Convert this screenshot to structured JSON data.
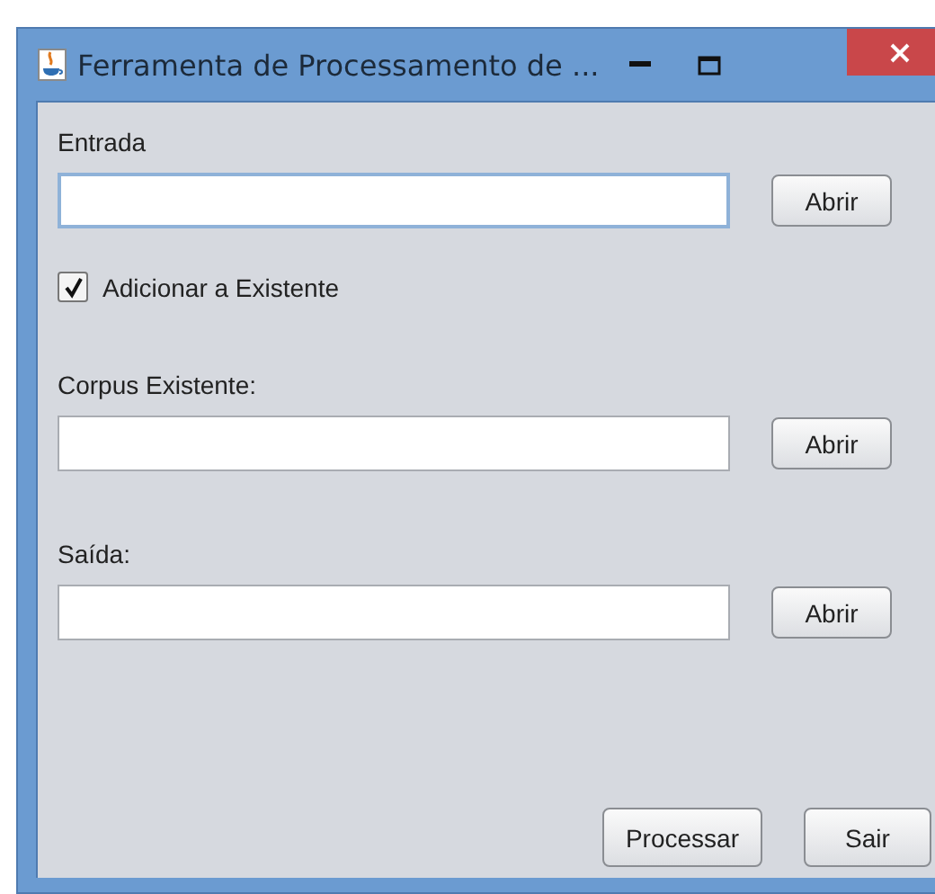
{
  "window": {
    "title": "Ferramenta de Processamento de ..."
  },
  "sections": [
    {
      "kind": "file",
      "label": "Entrada",
      "focused": true,
      "button": "Abrir"
    },
    {
      "kind": "checkbox",
      "label": "Adicionar a Existente",
      "checked": true
    },
    {
      "kind": "file",
      "label": "Corpus Existente:",
      "focused": false,
      "button": "Abrir"
    },
    {
      "kind": "file",
      "label": "Saída:",
      "focused": false,
      "button": "Abrir"
    }
  ],
  "buttons": [
    "Processar",
    "Sair"
  ]
}
